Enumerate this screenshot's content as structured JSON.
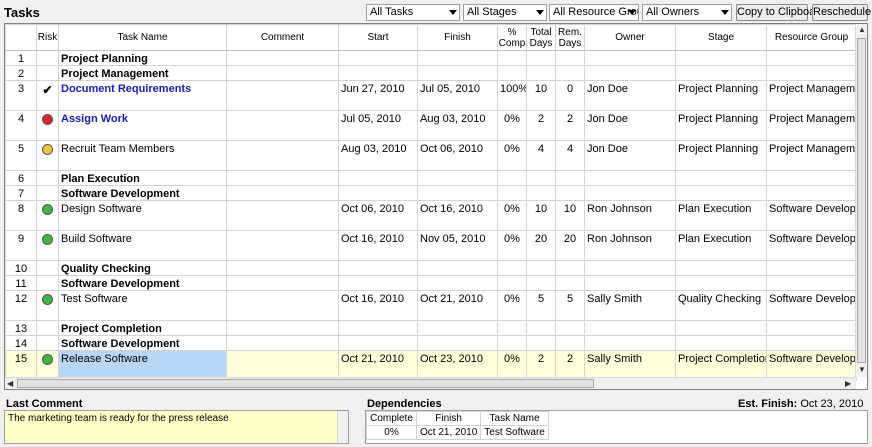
{
  "title": "Tasks",
  "filters": [
    {
      "name": "tasks-filter",
      "value": "All Tasks"
    },
    {
      "name": "stages-filter",
      "value": "All Stages"
    },
    {
      "name": "resource-groups-filter",
      "value": "All Resource Groups"
    },
    {
      "name": "owners-filter",
      "value": "All Owners"
    }
  ],
  "buttons": {
    "copy": "Copy to Clipboard",
    "reschedule": "Reschedule"
  },
  "columns": {
    "risk": "Risk",
    "task": "Task Name",
    "comment": "Comment",
    "start": "Start",
    "finish": "Finish",
    "comp_1": "%",
    "comp_2": "Comp",
    "total_1": "Total",
    "total_2": "Days",
    "rem_1": "Rem.",
    "rem_2": "Days",
    "owner": "Owner",
    "stage": "Stage",
    "group": "Resource Group"
  },
  "rows": [
    {
      "num": "1",
      "kind": "phase",
      "name": "Project Planning"
    },
    {
      "num": "2",
      "kind": "group",
      "name": "Project Management"
    },
    {
      "num": "3",
      "kind": "task",
      "risk": "check",
      "link": true,
      "name": "Document Requirements",
      "comment": "",
      "start": "Jun 27, 2010",
      "finish": "Jul 05, 2010",
      "comp": "100%",
      "total": "10",
      "rem": "0",
      "owner": "Jon Doe",
      "stage": "Project Planning",
      "group": "Project Management"
    },
    {
      "num": "4",
      "kind": "task",
      "risk": "red",
      "link": true,
      "name": "Assign Work",
      "comment": "",
      "start": "Jul 05, 2010",
      "finish": "Aug 03, 2010",
      "comp": "0%",
      "total": "2",
      "rem": "2",
      "owner": "Jon Doe",
      "stage": "Project Planning",
      "group": "Project Management"
    },
    {
      "num": "5",
      "kind": "task",
      "risk": "yellow",
      "link": false,
      "name": "Recruit Team Members",
      "comment": "",
      "start": "Aug 03, 2010",
      "finish": "Oct 06, 2010",
      "comp": "0%",
      "total": "4",
      "rem": "4",
      "owner": "Jon Doe",
      "stage": "Project Planning",
      "group": "Project Management"
    },
    {
      "num": "6",
      "kind": "phase",
      "name": "Plan Execution"
    },
    {
      "num": "7",
      "kind": "group",
      "name": "Software Development"
    },
    {
      "num": "8",
      "kind": "task",
      "risk": "green",
      "link": false,
      "name": "Design Software",
      "comment": "",
      "start": "Oct 06, 2010",
      "finish": "Oct 16, 2010",
      "comp": "0%",
      "total": "10",
      "rem": "10",
      "owner": "Ron Johnson",
      "stage": "Plan Execution",
      "group": "Software Development"
    },
    {
      "num": "9",
      "kind": "task",
      "risk": "green",
      "link": false,
      "name": "Build Software",
      "comment": "",
      "start": "Oct 16, 2010",
      "finish": "Nov 05, 2010",
      "comp": "0%",
      "total": "20",
      "rem": "20",
      "owner": "Ron Johnson",
      "stage": "Plan Execution",
      "group": "Software Development"
    },
    {
      "num": "10",
      "kind": "phase",
      "name": "Quality Checking"
    },
    {
      "num": "11",
      "kind": "group",
      "name": "Software Development"
    },
    {
      "num": "12",
      "kind": "task",
      "risk": "green",
      "link": false,
      "name": "Test Software",
      "comment": "",
      "start": "Oct 16, 2010",
      "finish": "Oct 21, 2010",
      "comp": "0%",
      "total": "5",
      "rem": "5",
      "owner": "Sally Smith",
      "stage": "Quality Checking",
      "group": "Software Development"
    },
    {
      "num": "13",
      "kind": "phase",
      "name": "Project Completion"
    },
    {
      "num": "14",
      "kind": "group",
      "name": "Software Development"
    },
    {
      "num": "15",
      "kind": "task",
      "risk": "green",
      "link": false,
      "highlight": true,
      "name": "Release Software",
      "comment": "",
      "start": "Oct 21, 2010",
      "finish": "Oct 23, 2010",
      "comp": "0%",
      "total": "2",
      "rem": "2",
      "owner": "Sally Smith",
      "stage": "Project Completion",
      "group": "Software Development"
    }
  ],
  "risk_colors": {
    "red": "#d42a2a",
    "yellow": "#f2c43a",
    "green": "#3fb63f"
  },
  "last_comment": {
    "label": "Last Comment",
    "text": "The marketing team is ready for the press release"
  },
  "dependencies": {
    "label": "Dependencies",
    "est_finish_label": "Est. Finish:",
    "est_finish_value": "Oct 23, 2010",
    "columns": {
      "complete": "Complete",
      "finish": "Finish",
      "task": "Task Name"
    },
    "rows": [
      {
        "complete": "0%",
        "finish": "Oct 21, 2010",
        "task": "Test Software"
      }
    ]
  }
}
